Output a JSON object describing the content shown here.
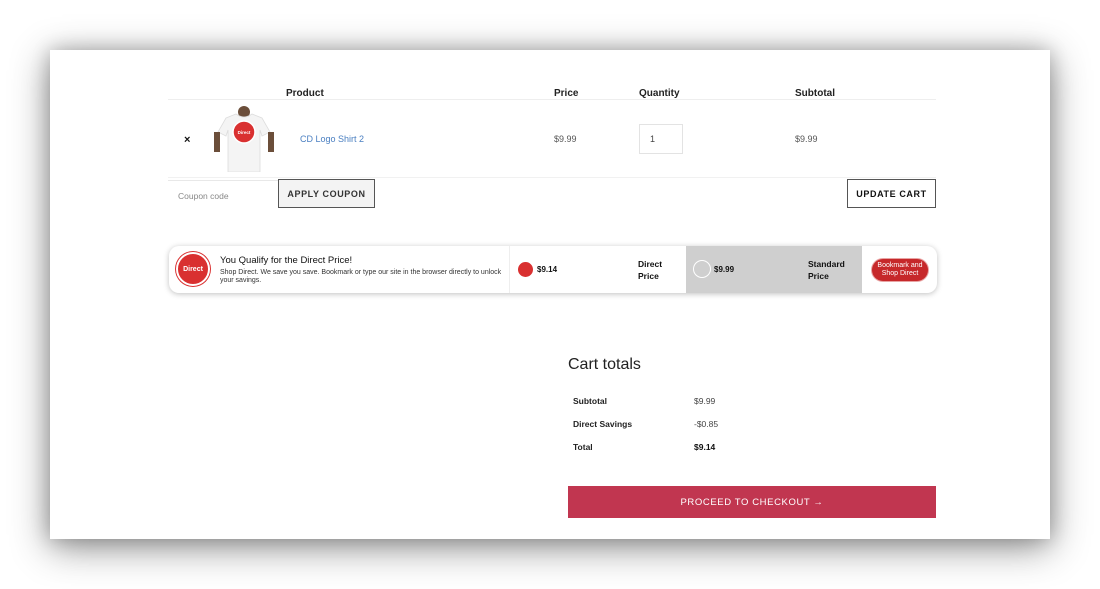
{
  "table": {
    "headers": {
      "product": "Product",
      "price": "Price",
      "quantity": "Quantity",
      "subtotal": "Subtotal"
    },
    "items": [
      {
        "remove": "×",
        "name": "CD Logo Shirt 2",
        "price": "$9.99",
        "quantity": "1",
        "subtotal": "$9.99"
      }
    ]
  },
  "actions": {
    "coupon_placeholder": "Coupon code",
    "apply_coupon": "APPLY COUPON",
    "update_cart": "UPDATE CART"
  },
  "direct_bar": {
    "logo_text": "Direct",
    "title": "You Qualify for the Direct Price!",
    "description": "Shop Direct. We save you save. Bookmark or type our site in the browser directly to unlock your savings.",
    "direct_price": "$9.14",
    "direct_label": "Direct Price",
    "standard_price": "$9.99",
    "standard_label": "Standard Price",
    "bookmark_button": "Bookmark and Shop Direct",
    "colors": {
      "accent_red": "#d93030",
      "standard_bg": "#cfcfcf"
    }
  },
  "totals": {
    "heading": "Cart totals",
    "rows": [
      {
        "label": "Subtotal",
        "value": "$9.99"
      },
      {
        "label": "Direct Savings",
        "value": "-$0.85"
      },
      {
        "label": "Total",
        "value": "$9.14"
      }
    ],
    "checkout_button": "PROCEED TO CHECKOUT →",
    "checkout_color": "#c13650"
  },
  "icons": {
    "remove": "close-icon",
    "product_image": "tshirt-image",
    "direct_logo": "direct-logo"
  }
}
